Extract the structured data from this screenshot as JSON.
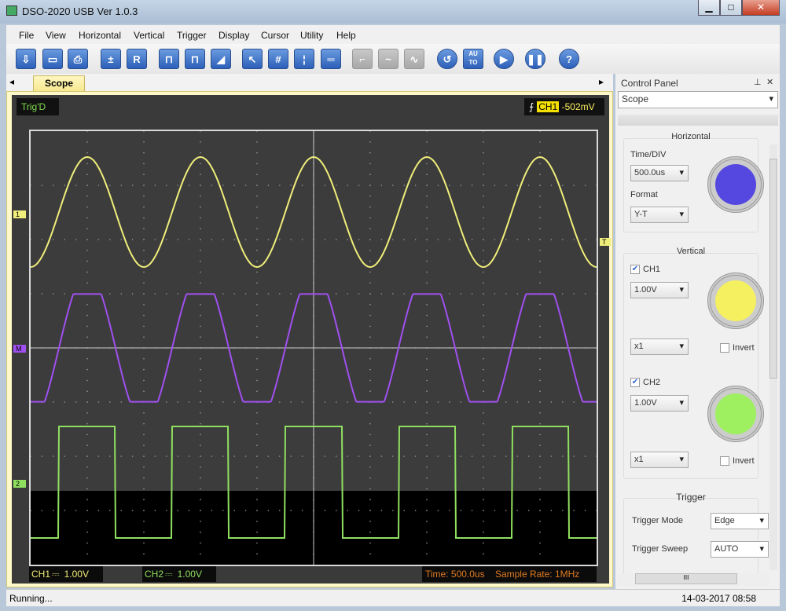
{
  "window": {
    "title": "DSO-2020 USB Ver 1.0.3",
    "min": "▁",
    "max": "□",
    "close": "✕"
  },
  "menu": [
    "File",
    "View",
    "Horizontal",
    "Vertical",
    "Trigger",
    "Display",
    "Cursor",
    "Utility",
    "Help"
  ],
  "toolbar": [
    {
      "icon": "open-icon",
      "glyph": "⇩"
    },
    {
      "icon": "save-icon",
      "glyph": "▭"
    },
    {
      "icon": "print-icon",
      "glyph": "⎙"
    },
    {
      "icon": "math-icon",
      "glyph": "±"
    },
    {
      "icon": "reference-icon",
      "glyph": "R"
    },
    {
      "icon": "pulse-icon",
      "glyph": "⊓"
    },
    {
      "icon": "pulse-dots-icon",
      "glyph": "⊓"
    },
    {
      "icon": "ramp-icon",
      "glyph": "◢"
    },
    {
      "icon": "pointer-icon",
      "glyph": "↖"
    },
    {
      "icon": "grid-icon",
      "glyph": "#"
    },
    {
      "icon": "vertical-cursor-icon",
      "glyph": "¦"
    },
    {
      "icon": "horizontal-cursor-icon",
      "glyph": "═"
    },
    {
      "icon": "step-icon",
      "glyph": "⌐"
    },
    {
      "icon": "wave-icon",
      "glyph": "~"
    },
    {
      "icon": "sine-icon",
      "glyph": "∿"
    },
    {
      "icon": "refresh-icon",
      "glyph": "↺"
    },
    {
      "icon": "auto-icon",
      "glyph": "AU TO"
    },
    {
      "icon": "play-icon",
      "glyph": "▶"
    },
    {
      "icon": "pause-icon",
      "glyph": "❚❚"
    },
    {
      "icon": "help-icon",
      "glyph": "?"
    }
  ],
  "tabs": {
    "active": "Scope",
    "left": "◂",
    "right": "▸"
  },
  "scope": {
    "trig_status": "Trig'D",
    "trig_channel": "CH1",
    "trig_level": "-502mV",
    "markers": {
      "ch1": "1",
      "math": "M",
      "ch2": "2",
      "trigger": "T"
    },
    "ch1_label": "CH1",
    "ch1_scale": "1.00V",
    "ch2_label": "CH2",
    "ch2_scale": "1.00V",
    "coupling": "⎓",
    "time": "Time: 500.0us",
    "sample_rate": "Sample Rate: 1MHz",
    "colors": {
      "ch1": "#f0ee7a",
      "math": "#a050f0",
      "ch2": "#90e060",
      "grid": "#9a9a9a"
    }
  },
  "panel": {
    "title": "Control Panel",
    "pin": "📌",
    "close": "✕",
    "view": "Scope",
    "horizontal": {
      "title": "Horizontal",
      "time_div_label": "Time/DIV",
      "time_div": "500.0us",
      "format_label": "Format",
      "format": "Y-T"
    },
    "vertical": {
      "title": "Vertical",
      "ch1": "CH1",
      "ch1_checked": true,
      "ch1_volt": "1.00V",
      "ch1_probe": "x1",
      "ch2": "CH2",
      "ch2_checked": true,
      "ch2_volt": "1.00V",
      "ch2_probe": "x1",
      "invert": "Invert"
    },
    "trigger": {
      "title": "Trigger",
      "mode_label": "Trigger Mode",
      "mode": "Edge",
      "sweep_label": "Trigger Sweep",
      "sweep": "AUTO"
    },
    "knob_colors": {
      "horizontal": "#5548e0",
      "ch1": "#f5f060",
      "ch2": "#9ef060"
    }
  },
  "status": {
    "text": "Running...",
    "datetime": "14-03-2017  08:58"
  }
}
